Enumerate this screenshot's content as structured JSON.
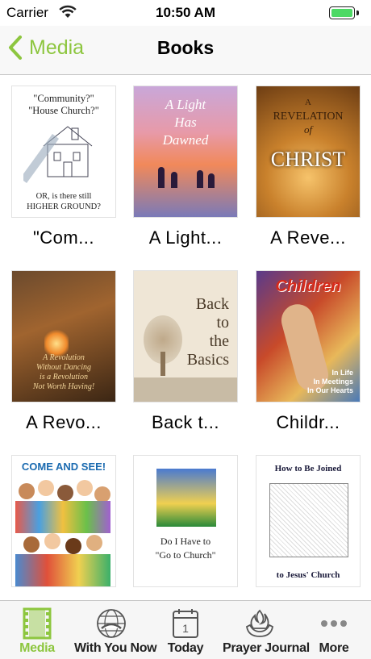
{
  "status": {
    "carrier": "Carrier",
    "time": "10:50 AM"
  },
  "nav": {
    "back_label": "Media",
    "title": "Books"
  },
  "books": [
    {
      "label": "\"Com...",
      "cover_title_1": "\"Community?\"",
      "cover_title_2": "\"House Church?\"",
      "cover_bottom_1": "OR, is there still",
      "cover_bottom_2": "HIGHER GROUND?"
    },
    {
      "label": "A Light...",
      "cover_title_1": "A Light",
      "cover_title_2": "Has",
      "cover_title_3": "Dawned"
    },
    {
      "label": "A Reve...",
      "cover_a": "A",
      "cover_r": "REVELATION",
      "cover_o": "of",
      "cover_c": "CHRIST"
    },
    {
      "label": "A Revo...",
      "cover_title_1": "A Revolution",
      "cover_title_2": "Without Dancing",
      "cover_title_3": "is a Revolution",
      "cover_title_4": "Not Worth Having!"
    },
    {
      "label": "Back t...",
      "cover_title_1": "Back",
      "cover_title_2": "to",
      "cover_title_3": "the",
      "cover_title_4": "Basics"
    },
    {
      "label": "Childr...",
      "cover_title": "Children",
      "cover_sub_1": "In Life",
      "cover_sub_2": "In Meetings",
      "cover_sub_3": "In Our Hearts"
    },
    {
      "label": "",
      "cover_title": "COME AND SEE!"
    },
    {
      "label": "",
      "cover_title_1": "Do I Have to",
      "cover_title_2": "\"Go to Church\""
    },
    {
      "label": "",
      "cover_title_1": "How to Be Joined",
      "cover_title_2": "to Jesus' Church"
    }
  ],
  "tabs": [
    {
      "label": "Media",
      "icon": "film-icon",
      "active": true
    },
    {
      "label": "With You Now",
      "icon": "globe-hands-icon",
      "active": false
    },
    {
      "label": "Today",
      "icon": "calendar-icon",
      "active": false
    },
    {
      "label": "Prayer Journal",
      "icon": "flame-hands-icon",
      "active": false
    },
    {
      "label": "More",
      "icon": "more-dots-icon",
      "active": false
    }
  ],
  "colors": {
    "accent": "#8dc63f",
    "battery": "#4cd964"
  }
}
